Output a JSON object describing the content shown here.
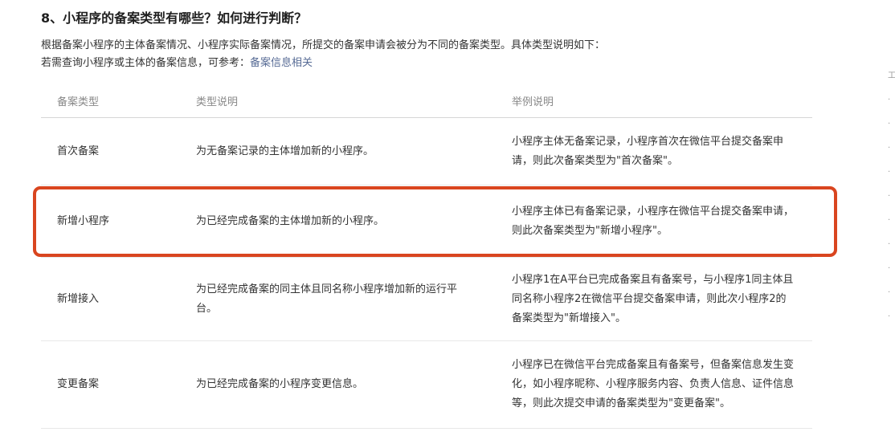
{
  "section": {
    "title": "8、小程序的备案类型有哪些？如何进行判断？",
    "intro_line1": "根据备案小程序的主体备案情况、小程序实际备案情况，所提交的备案申请会被分为不同的备案类型。具体类型说明如下：",
    "intro_line2_prefix": "若需查询小程序或主体的备案信息，可参考：",
    "intro_line2_link": "备案信息相关"
  },
  "table": {
    "headers": [
      "备案类型",
      "类型说明",
      "举例说明"
    ],
    "rows": [
      {
        "type": "首次备案",
        "desc": "为无备案记录的主体增加新的小程序。",
        "example": "小程序主体无备案记录，小程序首次在微信平台提交备案申请，则此次备案类型为\"首次备案\"。"
      },
      {
        "type": "新增小程序",
        "desc": "为已经完成备案的主体增加新的小程序。",
        "example": "小程序主体已有备案记录，小程序在微信平台提交备案申请，则此次备案类型为\"新增小程序\"。"
      },
      {
        "type": "新增接入",
        "desc": "为已经完成备案的同主体且同名称小程序增加新的运行平台。",
        "example": "小程序1在A平台已完成备案且有备案号，与小程序1同主体且同名称小程序2在微信平台提交备案申请，则此次小程序2的备案类型为\"新增接入\"。"
      },
      {
        "type": "变更备案",
        "desc": "为已经完成备案的小程序变更信息。",
        "example": "小程序已在微信平台完成备案且有备案号，但备案信息发生变化，如小程序昵称、小程序服务内容、负责人信息、证件信息等，则此次提交申请的备案类型为\"变更备案\"。"
      }
    ]
  },
  "highlight": {
    "row_index": 1,
    "color": "#d9451f"
  },
  "link_color": "#576b95"
}
